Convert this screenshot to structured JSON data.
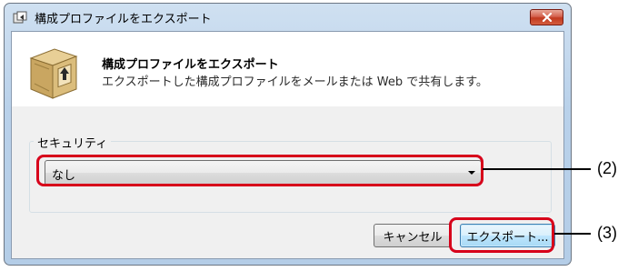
{
  "window": {
    "title": "構成プロファイルをエクスポート",
    "icons": {
      "app": "export-app-icon",
      "close": "close-icon"
    }
  },
  "header": {
    "title": "構成プロファイルをエクスポート",
    "description": "エクスポートした構成プロファイルをメールまたは Web で共有します。",
    "icon": "package-upload-icon"
  },
  "security": {
    "group_label": "セキュリティ",
    "selected_value": "なし"
  },
  "buttons": {
    "cancel_label": "キャンセル",
    "export_label": "エクスポート..."
  },
  "annotations": {
    "callout_2": "(2)",
    "callout_3": "(3)",
    "highlight_color": "#d7001a"
  },
  "colors": {
    "titlebar": "#b9d1ea",
    "close_button": "#c1391f",
    "default_button_border": "#3c7fb1"
  }
}
